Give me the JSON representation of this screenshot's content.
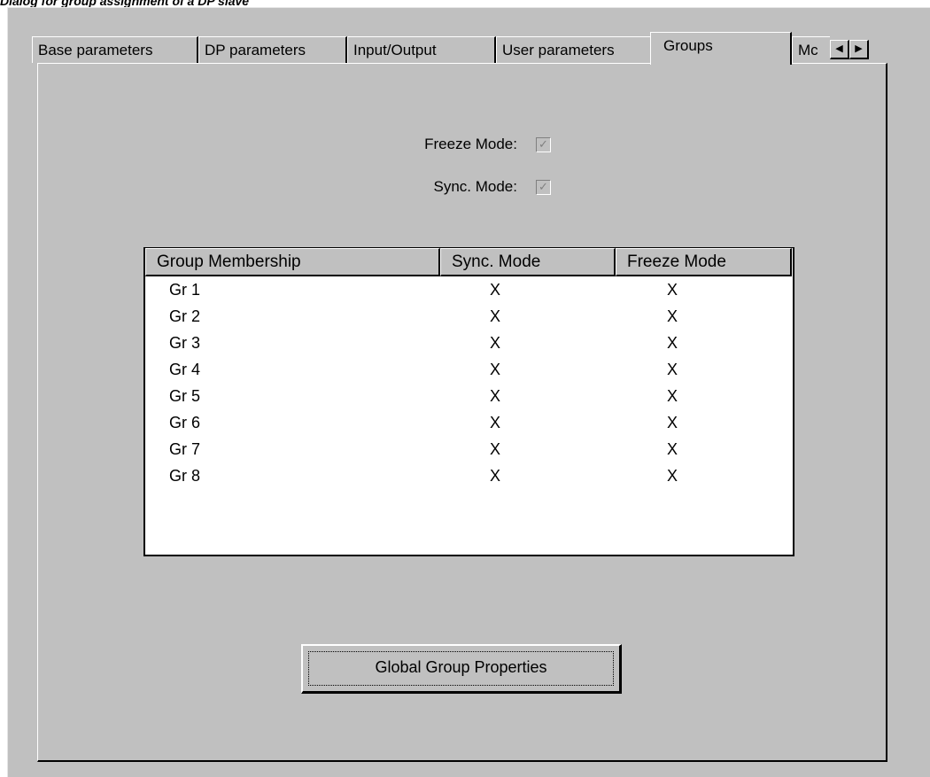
{
  "caption": "Dialog for group assignment of a DP slave",
  "tabs": [
    {
      "label": "Base parameters"
    },
    {
      "label": "DP parameters"
    },
    {
      "label": "Input/Output"
    },
    {
      "label": "User parameters"
    },
    {
      "label": "Groups"
    },
    {
      "label": "Mc"
    }
  ],
  "active_tab": "Groups",
  "tab_scroll": {
    "left_icon": "arrow-left-icon",
    "right_icon": "arrow-right-icon",
    "left_glyph": "◀",
    "right_glyph": "▶"
  },
  "modes": {
    "freeze_label": "Freeze Mode:",
    "freeze_checked": true,
    "sync_label": "Sync. Mode:",
    "sync_checked": true,
    "check_glyph": "✓"
  },
  "table": {
    "headers": [
      "Group Membership",
      "Sync. Mode",
      "Freeze Mode"
    ],
    "rows": [
      [
        "Gr 1",
        "X",
        "X"
      ],
      [
        "Gr 2",
        "X",
        "X"
      ],
      [
        "Gr 3",
        "X",
        "X"
      ],
      [
        "Gr 4",
        "X",
        "X"
      ],
      [
        "Gr 5",
        "X",
        "X"
      ],
      [
        "Gr 6",
        "X",
        "X"
      ],
      [
        "Gr 7",
        "X",
        "X"
      ],
      [
        "Gr 8",
        "X",
        "X"
      ]
    ]
  },
  "button_label": "Global Group Properties",
  "colors": {
    "face": "#c0c0c0",
    "highlight": "#ffffff",
    "shadow": "#000000",
    "disabled": "#808080"
  }
}
